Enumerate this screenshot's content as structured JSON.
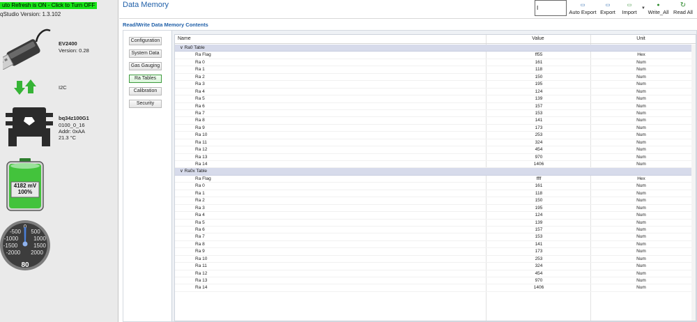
{
  "status": {
    "auto_refresh": "uto Refresh is ON - Click to Turn OFF",
    "studio_version": "qStudio Version:  1.3.102"
  },
  "device": {
    "adapter_name": "EV2400",
    "adapter_version": "Version: 0.28",
    "bus": "I2C",
    "chip_name": "bq34z100G1",
    "chip_fw": "0100_0_16",
    "chip_addr": "Addr: 0xAA",
    "chip_temp": "21.3 °C",
    "battery_voltage": "4182 mV",
    "battery_percent": "100%",
    "battery_level": 1.0,
    "gauge_value": "80",
    "gauge_ticks": [
      "0",
      "-500",
      "500",
      "-1000",
      "1000",
      "-1500",
      "1500",
      "-2000",
      "2000"
    ]
  },
  "header": {
    "title": "Data Memory",
    "input_value": "I",
    "buttons": [
      "Auto Export",
      "Export",
      "Import",
      "Write_All",
      "Read All"
    ]
  },
  "section_title": "Read/Write Data Memory Contents",
  "nav": {
    "items": [
      "Configuration",
      "System Data",
      "Gas Gauging",
      "Ra Tables",
      "Calibration",
      "Security"
    ],
    "active": "Ra Tables"
  },
  "grid": {
    "columns": [
      "Name",
      "Value",
      "Unit"
    ],
    "groups": [
      {
        "label": "Ra0 Table",
        "rows": [
          [
            "Ra Flag",
            "ff55",
            "Hex"
          ],
          [
            "Ra 0",
            "161",
            "Num"
          ],
          [
            "Ra 1",
            "118",
            "Num"
          ],
          [
            "Ra 2",
            "150",
            "Num"
          ],
          [
            "Ra 3",
            "195",
            "Num"
          ],
          [
            "Ra 4",
            "124",
            "Num"
          ],
          [
            "Ra 5",
            "139",
            "Num"
          ],
          [
            "Ra 6",
            "157",
            "Num"
          ],
          [
            "Ra 7",
            "153",
            "Num"
          ],
          [
            "Ra 8",
            "141",
            "Num"
          ],
          [
            "Ra 9",
            "173",
            "Num"
          ],
          [
            "Ra 10",
            "253",
            "Num"
          ],
          [
            "Ra 11",
            "324",
            "Num"
          ],
          [
            "Ra 12",
            "454",
            "Num"
          ],
          [
            "Ra 13",
            "970",
            "Num"
          ],
          [
            "Ra 14",
            "1406",
            "Num"
          ]
        ]
      },
      {
        "label": "Ra0x Table",
        "rows": [
          [
            "Ra Flag",
            "ffff",
            "Hex"
          ],
          [
            "Ra 0",
            "161",
            "Num"
          ],
          [
            "Ra 1",
            "118",
            "Num"
          ],
          [
            "Ra 2",
            "150",
            "Num"
          ],
          [
            "Ra 3",
            "195",
            "Num"
          ],
          [
            "Ra 4",
            "124",
            "Num"
          ],
          [
            "Ra 5",
            "139",
            "Num"
          ],
          [
            "Ra 6",
            "157",
            "Num"
          ],
          [
            "Ra 7",
            "153",
            "Num"
          ],
          [
            "Ra 8",
            "141",
            "Num"
          ],
          [
            "Ra 9",
            "173",
            "Num"
          ],
          [
            "Ra 10",
            "253",
            "Num"
          ],
          [
            "Ra 11",
            "324",
            "Num"
          ],
          [
            "Ra 12",
            "454",
            "Num"
          ],
          [
            "Ra 13",
            "970",
            "Num"
          ],
          [
            "Ra 14",
            "1406",
            "Num"
          ]
        ]
      }
    ]
  },
  "colors": {
    "accent": "#1f5fa8",
    "refresh_bg": "#19e619",
    "group_row_bg": "#d7dbeb",
    "battery_green": "#43c33c"
  }
}
